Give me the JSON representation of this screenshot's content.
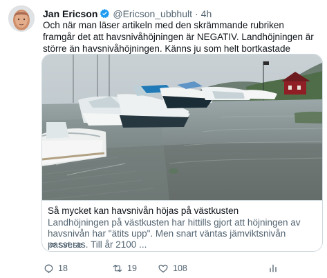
{
  "tweet": {
    "author_name": "Jan Ericson",
    "author_handle": "@Ericson_ubbhult",
    "separator": "·",
    "time": "4h",
    "text": "Och när man läser artikeln med den skrämmande rubriken framgår det att havsnivåhöjningen är NEGATIV. Landhöjningen är större än havsnivåhöjningen. Känns ju som helt bortkastade miljarder?"
  },
  "card": {
    "title": "Så mycket kan havsnivån höjas på västkusten",
    "description": "Landhöjningen på västkusten har hittills gjort att höjningen av havsnivån har \"ätits upp\". Men snart väntas jämviktsnivån passeras. Till år 2100 ...",
    "domain": "svt.se"
  },
  "actions": {
    "reply_count": "18",
    "retweet_count": "19",
    "like_count": "108"
  },
  "icons": {
    "verified": "verified-badge-icon",
    "link": "link-icon",
    "reply": "reply-icon",
    "retweet": "retweet-icon",
    "like": "heart-icon",
    "analytics": "analytics-icon"
  },
  "colors": {
    "accent": "#1d9bf0",
    "text_primary": "#0f1419",
    "text_secondary": "#536471",
    "border": "#cfd9de"
  }
}
